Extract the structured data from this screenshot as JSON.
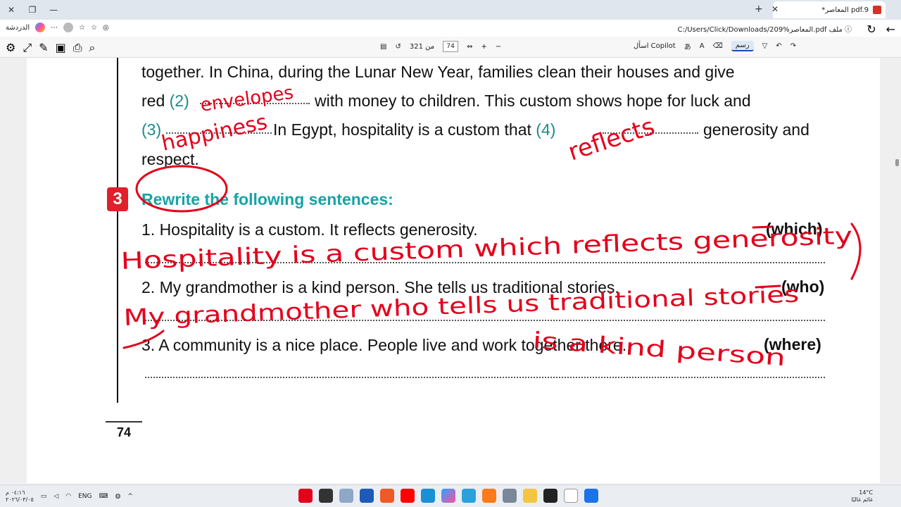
{
  "browser": {
    "tab_title": "*المعاصر pdf.9",
    "url": "C:/Users/Click/Downloads/209%المعاصر.pdf",
    "url_prefix": "ملف",
    "chat_label": "الدردشة"
  },
  "pdf_toolbar": {
    "page_current": "74",
    "page_total": "من 321",
    "copilot_label": "اسأل Copilot",
    "draw_label": "رسم"
  },
  "document": {
    "line1": "together. In China, during the Lunar New Year, families clean their houses and give",
    "line2_a": "red",
    "line2_num": "(2)",
    "line2_b": "with money to children. This custom shows hope for luck and",
    "line3_num": "(3)",
    "line3_a": "In Egypt, hospitality is a custom that",
    "line3_num2": "(4)",
    "line3_b": "generosity and",
    "line4": "respect.",
    "exercise_number": "3",
    "heading": "Rewrite the following sentences:",
    "q1": "1. Hospitality is a custom. It reflects generosity.",
    "q1_kw": "(which)",
    "q2": "2. My grandmother is a kind person. She tells us traditional stories.",
    "q2_kw": "(who)",
    "q3": "3. A community is a nice place. People live and work together there.",
    "q3_kw": "(where)",
    "page_number": "74"
  },
  "handwriting": {
    "blank2": "envelopes",
    "blank3": "happiness",
    "blank4": "reflects",
    "answer1": "Hospitality is a custom which reflects generosity",
    "answer2_a": "My grandmother who tells us traditional stories",
    "answer2_b": "is a kind person"
  },
  "taskbar": {
    "lang": "ENG",
    "time": "٠٤:١٦ م",
    "date": "٢٠٢٦/٠٣/٠٥",
    "temp": "14°C",
    "weather": "غائم غالبًا"
  },
  "colors": {
    "ink": "#e3001b",
    "teal": "#16a3a6",
    "badge": "#e0202a"
  }
}
